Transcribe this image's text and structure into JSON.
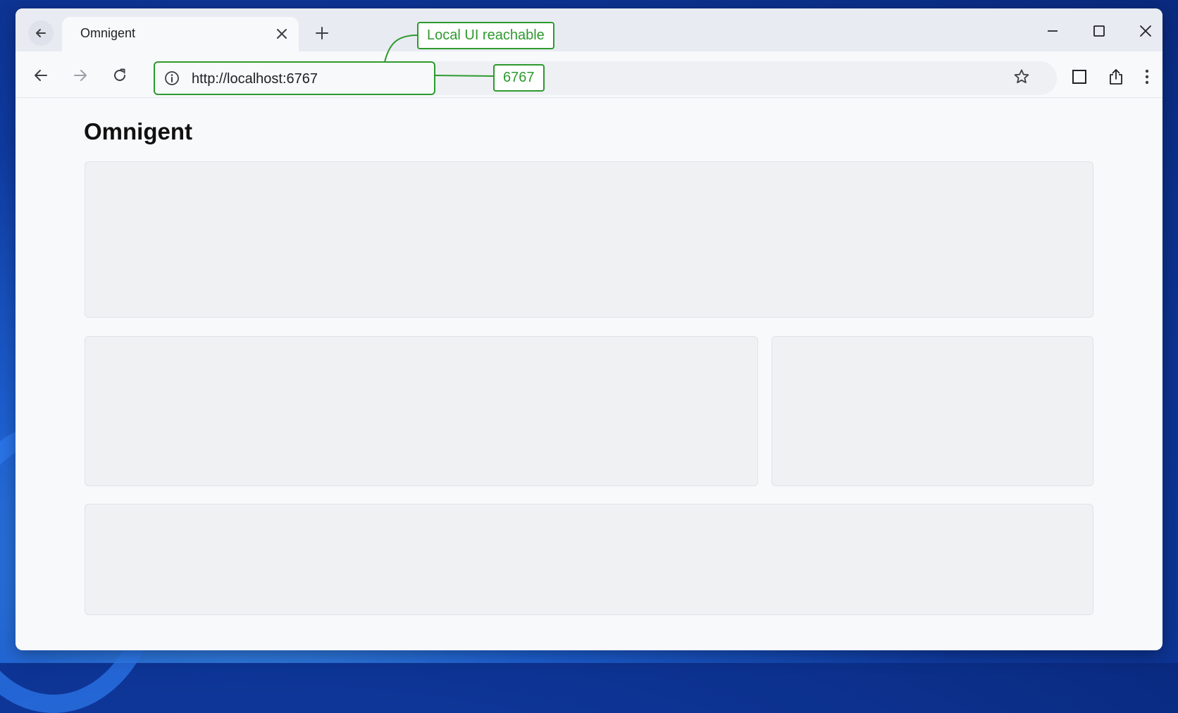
{
  "tab": {
    "title": "Omnigent"
  },
  "address_bar": {
    "url": "http://localhost:6767"
  },
  "annotations": {
    "local_ui": "Local UI reachable",
    "port": "6767"
  },
  "page": {
    "heading": "Omnigent"
  },
  "colors": {
    "annotation_green": "#2e9a2e",
    "window_bg": "#f8f9fb",
    "panel_bg": "#f0f1f3"
  },
  "icons": [
    "back-arrow-icon",
    "close-icon",
    "plus-icon",
    "minimize-icon",
    "maximize-icon",
    "forward-arrow-icon",
    "reload-icon",
    "info-icon",
    "star-icon",
    "side-panel-icon",
    "share-icon",
    "kebab-menu-icon"
  ]
}
